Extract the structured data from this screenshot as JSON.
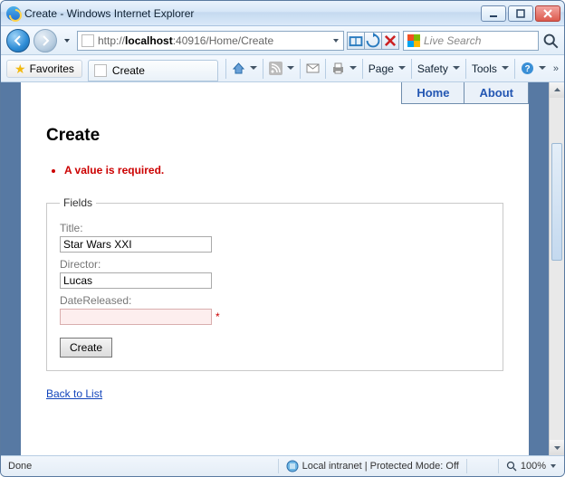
{
  "window": {
    "title": "Create - Windows Internet Explorer"
  },
  "address": {
    "prefix": "http://",
    "host": "localhost",
    "rest": ":40916/Home/Create"
  },
  "search": {
    "placeholder": "Live Search"
  },
  "favorites": {
    "label": "Favorites"
  },
  "tab": {
    "title": "Create"
  },
  "toolbar": {
    "page": "Page",
    "safety": "Safety",
    "tools": "Tools"
  },
  "nav_tabs": {
    "home": "Home",
    "about": "About"
  },
  "page": {
    "heading": "Create",
    "error": "A value is required.",
    "legend": "Fields",
    "title_label": "Title:",
    "title_value": "Star Wars XXI",
    "director_label": "Director:",
    "director_value": "Lucas",
    "date_label": "DateReleased:",
    "date_value": "",
    "required_marker": "*",
    "submit": "Create",
    "back": "Back to List"
  },
  "status": {
    "done": "Done",
    "zone": "Local intranet | Protected Mode: Off",
    "zoom": "100%"
  }
}
